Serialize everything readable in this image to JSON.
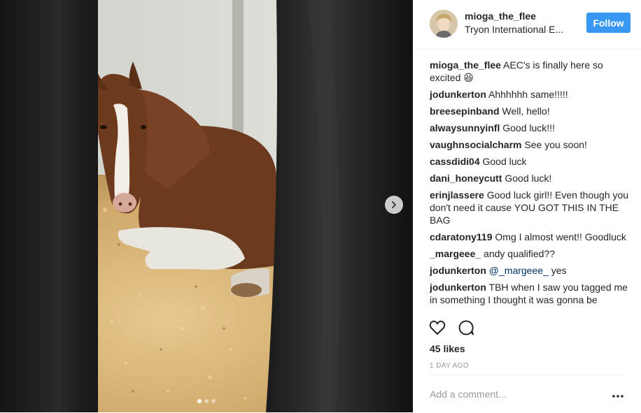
{
  "post": {
    "username": "mioga_the_flee",
    "location": "Tryon International E...",
    "follow_label": "Follow",
    "likes": "45 likes",
    "time": "1 DAY AGO",
    "add_comment_placeholder": "Add a comment..."
  },
  "comments": [
    {
      "user": "mioga_the_flee",
      "text": " AEC's is finally here so excited 😆"
    },
    {
      "user": "jodunkerton",
      "text": " Ahhhhhh same!!!!!"
    },
    {
      "user": "breesepinband",
      "text": " Well, hello!"
    },
    {
      "user": "alwaysunnyinfl",
      "text": " Good luck!!!"
    },
    {
      "user": "vaughnsocialcharm",
      "text": " See you soon!"
    },
    {
      "user": "cassdidi04",
      "text": " Good luck"
    },
    {
      "user": "dani_honeycutt",
      "text": " Good luck!"
    },
    {
      "user": "erinjlassere",
      "text": " Good luck girl!! Even though you don't need it cause YOU GOT THIS IN THE BAG"
    },
    {
      "user": "cdaratony119",
      "text": " Omg I almost went!! Goodluck"
    },
    {
      "user": "_margeee_",
      "text": " andy qualified??"
    },
    {
      "user": "jodunkerton",
      "mention": " @_margeee_",
      "text": " yes"
    },
    {
      "user": "jodunkerton",
      "text": " TBH when I saw you tagged me in something I thought it was gonna be"
    }
  ],
  "icons": {
    "like": "heart-icon",
    "comment": "comment-icon",
    "next": "chevron-right-icon",
    "more": "more-options-icon"
  },
  "colors": {
    "follow_button": "#3897f0",
    "text": "#262626",
    "muted": "#999999",
    "mention": "#003569"
  },
  "carousel": {
    "slides": 3,
    "active": 1
  }
}
